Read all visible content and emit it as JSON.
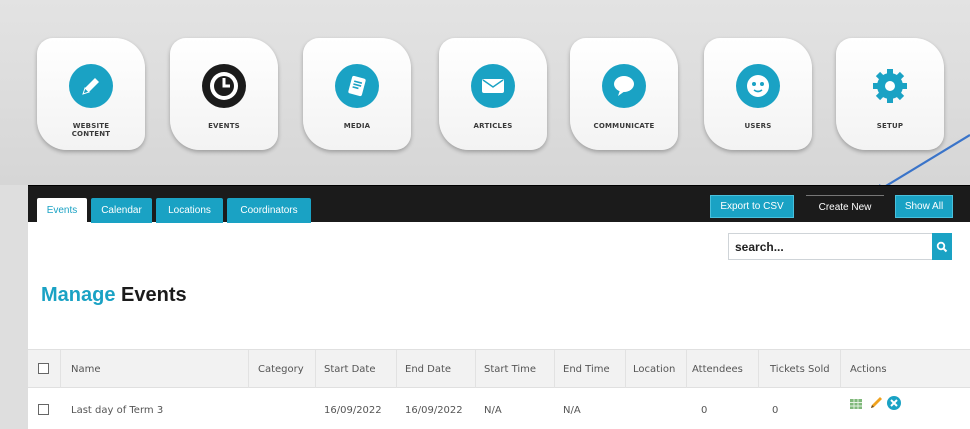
{
  "nav": {
    "tiles": [
      {
        "label": "WEBSITE\nCONTENT",
        "icon": "edit-icon"
      },
      {
        "label": "EVENTS",
        "icon": "clock-icon"
      },
      {
        "label": "MEDIA",
        "icon": "media-icon"
      },
      {
        "label": "ARTICLES",
        "icon": "envelope-icon"
      },
      {
        "label": "COMMUNICATE",
        "icon": "speech-bubble-icon"
      },
      {
        "label": "USERS",
        "icon": "user-icon"
      },
      {
        "label": "SETUP",
        "icon": "gear-icon"
      }
    ]
  },
  "tabs": [
    "Events",
    "Calendar",
    "Locations",
    "Coordinators"
  ],
  "active_tab": "Events",
  "header_buttons": {
    "export": "Export to CSV",
    "create": "Create New",
    "show_all": "Show All"
  },
  "search": {
    "value": "search..."
  },
  "page_title": {
    "accent": "Manage",
    "rest": "Events"
  },
  "table": {
    "columns": [
      "Name",
      "Category",
      "Start Date",
      "End Date",
      "Start Time",
      "End Time",
      "Location",
      "Attendees",
      "Tickets Sold",
      "Actions"
    ],
    "rows": [
      {
        "name": "Last day of Term 3",
        "category": "",
        "start_date": "16/09/2022",
        "end_date": "16/09/2022",
        "start_time": "N/A",
        "end_time": "N/A",
        "location": "",
        "attendees": "0",
        "tickets_sold": "0"
      }
    ]
  },
  "colors": {
    "accent": "#1aa2c4",
    "dark": "#1b1b1b",
    "arrow": "#3a74c9"
  }
}
